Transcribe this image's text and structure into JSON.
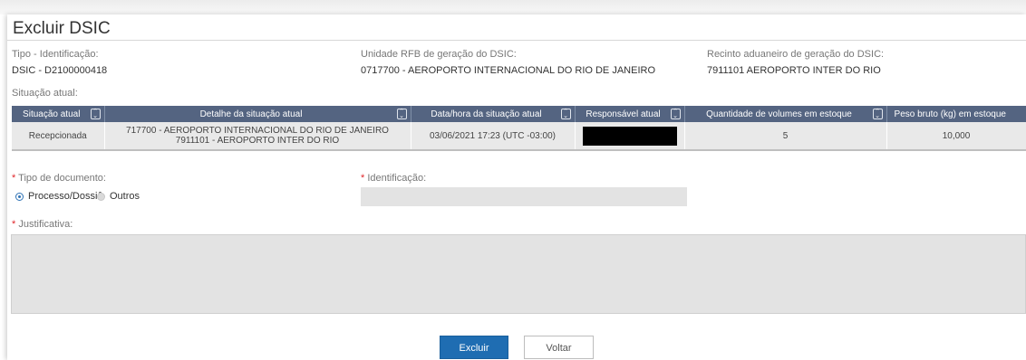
{
  "page": {
    "title": "Excluir DSIC"
  },
  "info": {
    "tipo_label": "Tipo - Identificação:",
    "tipo_value": "DSIC - D2100000418",
    "unidade_label": "Unidade RFB de geração do DSIC:",
    "unidade_value": "0717700 - AEROPORTO INTERNACIONAL DO RIO DE JANEIRO",
    "recinto_label": "Recinto aduaneiro de geração do DSIC:",
    "recinto_value": "7911101 AEROPORTO INTER DO RIO",
    "situacao_label": "Situação atual:"
  },
  "table": {
    "headers": [
      "Situação atual",
      "Detalhe da situação atual",
      "Data/hora da situação atual",
      "Responsável atual",
      "Quantidade de volumes em estoque",
      "Peso bruto (kg) em estoque"
    ],
    "row": {
      "situacao": "Recepcionada",
      "detalhe_line1": "717700 - AEROPORTO INTERNACIONAL DO RIO DE JANEIRO",
      "detalhe_line2": "7911101 - AEROPORTO INTER DO RIO",
      "data_hora": "03/06/2021 17:23 (UTC -03:00)",
      "responsavel": "",
      "quantidade": "5",
      "peso": "10,000"
    }
  },
  "form": {
    "required_mark": "*",
    "tipo_documento_label": "Tipo de documento:",
    "option_processo": "Processo/Dossiê",
    "option_outros": "Outros",
    "selected_option": "Processo/Dossiê",
    "identificacao_label": "Identificação:",
    "identificacao_value": "",
    "justificativa_label": "Justificativa:",
    "justificativa_value": ""
  },
  "buttons": {
    "excluir": "Excluir",
    "voltar": "Voltar"
  },
  "colors": {
    "header_bg": "#546481",
    "primary": "#1f6db2",
    "required": "#e0262a"
  }
}
